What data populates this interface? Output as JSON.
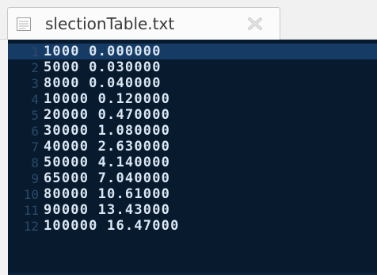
{
  "tab": {
    "title": "slectionTable.txt",
    "icon": "text-file-icon",
    "close_icon": "close-icon"
  },
  "editor": {
    "current_line": 1,
    "lines": [
      {
        "number": "1",
        "text": "1000 0.000000"
      },
      {
        "number": "2",
        "text": "5000 0.030000"
      },
      {
        "number": "3",
        "text": "8000 0.040000"
      },
      {
        "number": "4",
        "text": "10000 0.120000"
      },
      {
        "number": "5",
        "text": "20000 0.470000"
      },
      {
        "number": "6",
        "text": "30000 1.080000"
      },
      {
        "number": "7",
        "text": "40000 2.630000"
      },
      {
        "number": "8",
        "text": "50000 4.140000"
      },
      {
        "number": "9",
        "text": "65000 7.040000"
      },
      {
        "number": "10",
        "text": "80000 10.61000"
      },
      {
        "number": "11",
        "text": "90000 13.43000"
      },
      {
        "number": "12",
        "text": "100000 16.47000"
      }
    ]
  },
  "colors": {
    "editor_background": "#071a2e",
    "current_line_highlight": "#163c66",
    "text": "#dce7f3",
    "line_numbers": "#2c4a6b"
  }
}
